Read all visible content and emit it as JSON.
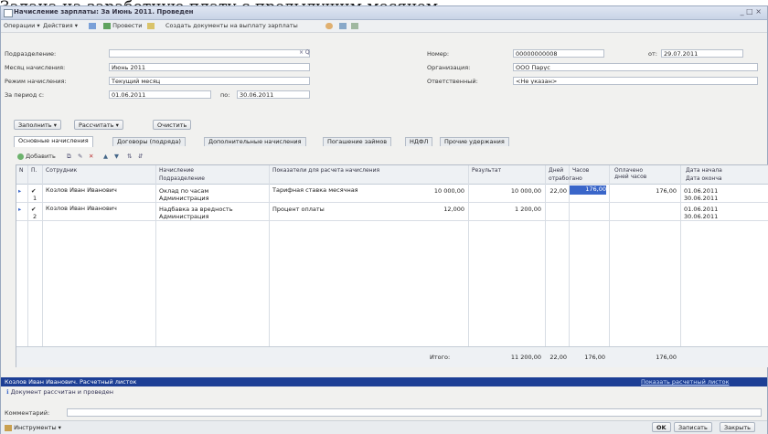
{
  "caption": "Задача на заработную плату с предыдущим месяцем",
  "window": {
    "title": "Начисление зарплаты: За Июнь 2011. Проведен",
    "controls": "_ □ ×"
  },
  "toolbar": {
    "operations": "Операции ▾",
    "actions": "Действия ▾",
    "post": "Провести",
    "create_docs": "Создать документы на выплату зарплаты"
  },
  "form": {
    "department_label": "Подразделение:",
    "department_value": "",
    "month_label": "Месяц начисления:",
    "month_value": "Июнь 2011",
    "mode_label": "Режим начисления:",
    "mode_value": "Текущий месяц",
    "period_label": "За период с:",
    "period_from": "01.06.2011",
    "period_to_label": "по:",
    "period_to": "30.06.2011",
    "number_label": "Номер:",
    "number_value": "00000000008",
    "date_label": "от:",
    "date_value": "29.07.2011",
    "org_label": "Организация:",
    "org_value": "ООО Парус",
    "resp_label": "Ответственный:",
    "resp_value": "<Не указан>"
  },
  "buttons": {
    "fill": "Заполнить ▾",
    "calculate": "Рассчитать ▾",
    "clear": "Очистить"
  },
  "tabs": [
    "Основные начисления",
    "Договоры (подряда)",
    "Дополнительные начисления",
    "Погашение займов",
    "НДФЛ",
    "Прочие удержания"
  ],
  "grid_toolbar": {
    "add": "Добавить"
  },
  "grid": {
    "headers": {
      "n": "N",
      "p": "П.",
      "employee": "Сотрудник",
      "accrual": "Начисление",
      "department": "Подразделение",
      "indicators": "Показатели для расчета начисления",
      "result": "Результат",
      "days": "Дней",
      "hours": "Часов",
      "worked": "отработано",
      "paid": "Оплачено дней часов",
      "start": "Дата начала",
      "end": "Дата оконча"
    },
    "rows": [
      {
        "num": "1",
        "employee": "Козлов Иван Иванович",
        "accrual": "Оклад по часам",
        "department": "Администрация",
        "indicator": "Тарифная ставка месячная",
        "amount": "10 000,00",
        "result": "10 000,00",
        "days": "22,00",
        "hours": "176,00",
        "paid": "176,00",
        "start": "01.06.2011",
        "end": "30.06.2011"
      },
      {
        "num": "2",
        "employee": "Козлов Иван Иванович",
        "accrual": "Надбавка за вредность",
        "department": "Администрация",
        "indicator": "Процент оплаты",
        "amount": "12,000",
        "result": "1 200,00",
        "days": "",
        "hours": "",
        "paid": "",
        "start": "01.06.2011",
        "end": "30.06.2011"
      }
    ],
    "totals": {
      "label": "Итого:",
      "result": "11 200,00",
      "days": "22,00",
      "hours": "176,00",
      "paid": "176,00"
    }
  },
  "status": {
    "employee_line": "Козлов Иван Иванович. Расчетный листок",
    "show_link": "Показать расчетный листок",
    "info": "Документ рассчитан и проведен"
  },
  "comment_label": "Комментарий:",
  "footer": {
    "tools": "Инструменты ▾",
    "ok": "OK",
    "save": "Записать",
    "close": "Закрыть"
  },
  "colors": {
    "title_bar": "#c8d3e6",
    "selection": "#3a66c9",
    "status_bar": "#1d3f95"
  }
}
